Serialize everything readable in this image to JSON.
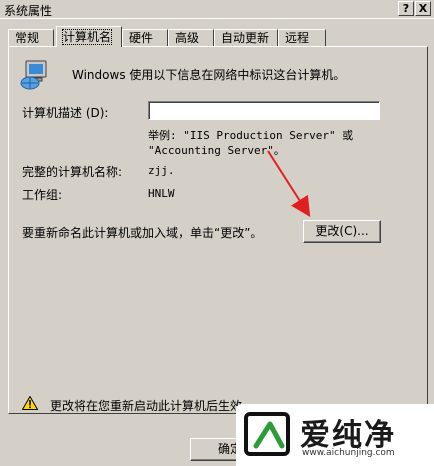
{
  "window": {
    "title": "系统属性",
    "help_btn": "?",
    "close_btn": "X"
  },
  "tabs": [
    {
      "label": "常规"
    },
    {
      "label": "计算机名",
      "active": true
    },
    {
      "label": "硬件"
    },
    {
      "label": "高级"
    },
    {
      "label": "自动更新"
    },
    {
      "label": "远程"
    }
  ],
  "panel": {
    "intro_text": "Windows 使用以下信息在网络中标识这台计算机。",
    "description_label": "计算机描述 (D):",
    "description_value": "",
    "example_line1": "举例: \"IIS Production Server\" 或",
    "example_line2": "\"Accounting Server\"。",
    "fullname_label": "完整的计算机名称:",
    "fullname_value": "zjj.",
    "workgroup_label": "工作组:",
    "workgroup_value": "HNLW",
    "rename_text": "要重新命名此计算机或加入域，单击“更改”。",
    "change_button": "更改(C)...",
    "warning_text": "更改将在您重新启动此计算机后生效。"
  },
  "footer": {
    "ok_button": "确定"
  },
  "watermark": {
    "brand": "爱纯净",
    "url": "www.aichunjing.com"
  },
  "colors": {
    "face": "#d4d0c8",
    "arrow": "#e02020"
  }
}
